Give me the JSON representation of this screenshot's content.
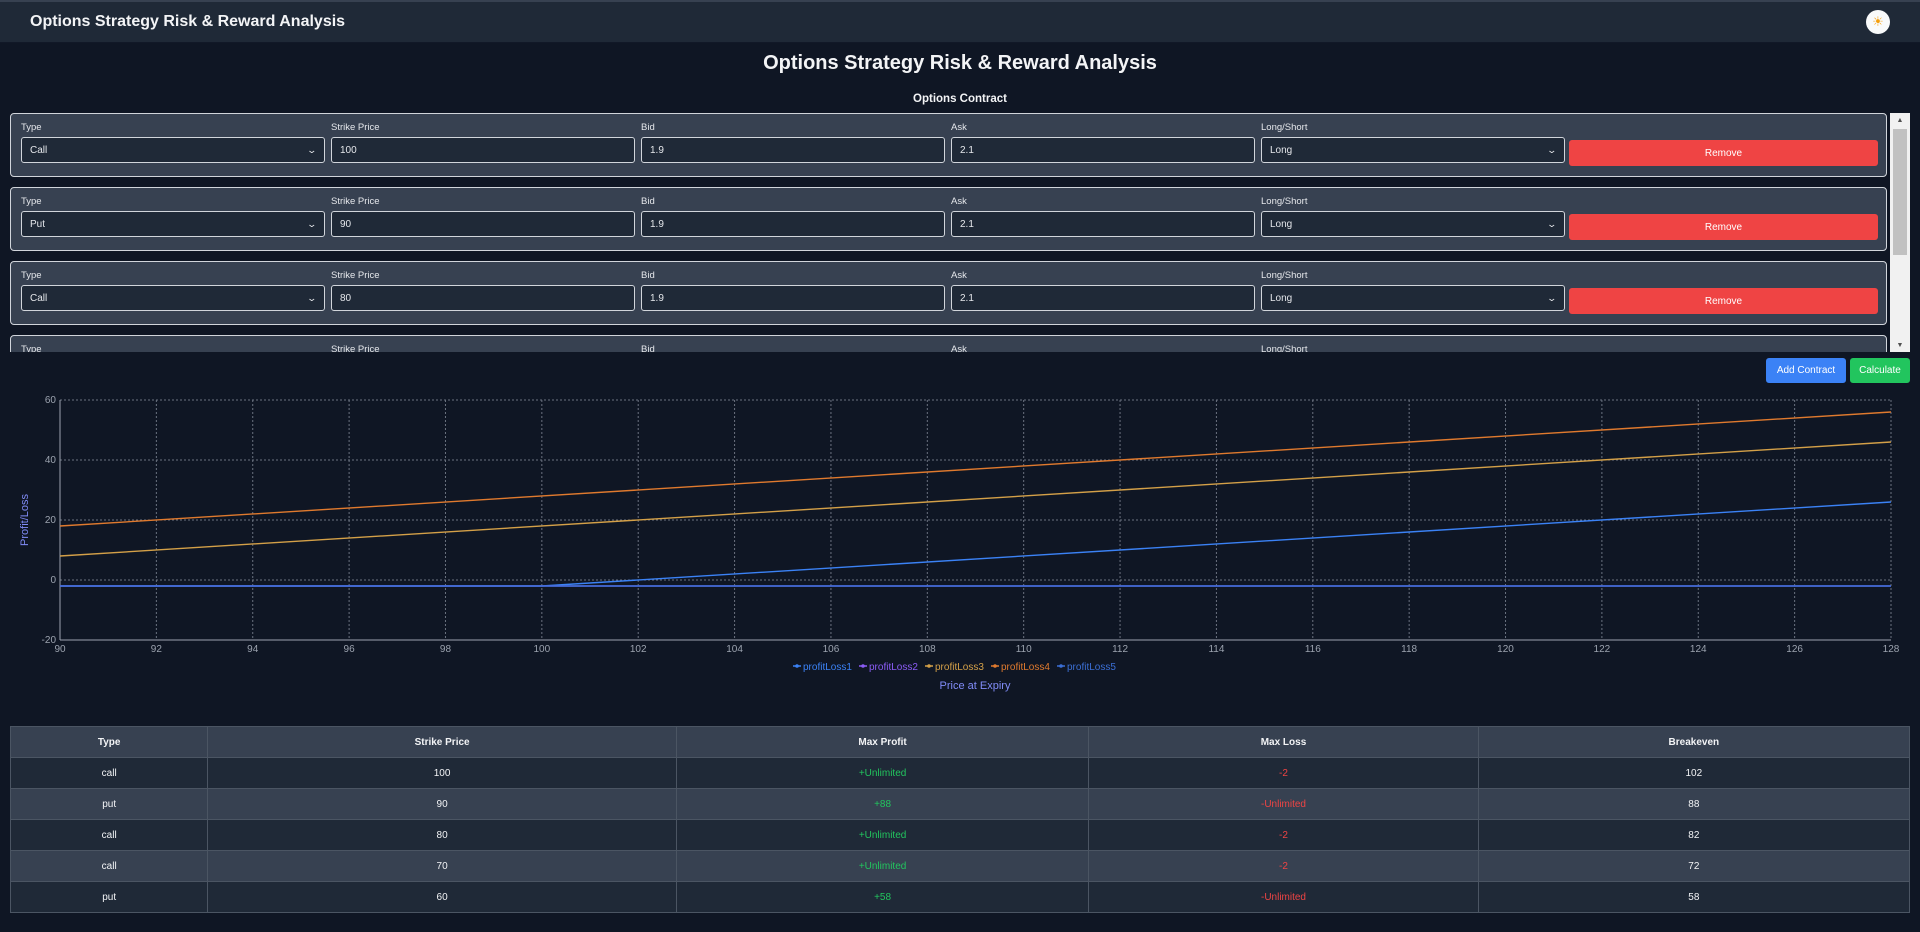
{
  "header": {
    "title": "Options Strategy Risk & Reward Analysis",
    "theme_icon": "sun-icon"
  },
  "page": {
    "title": "Options Strategy Risk & Reward Analysis",
    "section_label": "Options Contract"
  },
  "field_labels": {
    "type": "Type",
    "strike": "Strike Price",
    "bid": "Bid",
    "ask": "Ask",
    "side": "Long/Short"
  },
  "contracts": [
    {
      "type": "Call",
      "strike": "100",
      "bid": "1.9",
      "ask": "2.1",
      "side": "Long",
      "remove_label": "Remove"
    },
    {
      "type": "Put",
      "strike": "90",
      "bid": "1.9",
      "ask": "2.1",
      "side": "Long",
      "remove_label": "Remove"
    },
    {
      "type": "Call",
      "strike": "80",
      "bid": "1.9",
      "ask": "2.1",
      "side": "Long",
      "remove_label": "Remove"
    },
    {
      "type": "",
      "strike": "",
      "bid": "",
      "ask": "",
      "side": "",
      "remove_label": "Remove"
    }
  ],
  "actions": {
    "add_label": "Add Contract",
    "calc_label": "Calculate"
  },
  "chart_data": {
    "type": "line",
    "xlabel": "Price at Expiry",
    "ylabel": "Profit/Loss",
    "xlim": [
      90,
      128
    ],
    "ylim": [
      -20,
      60
    ],
    "x_ticks": [
      "90",
      "92",
      "94",
      "96",
      "98",
      "100",
      "102",
      "104",
      "106",
      "108",
      "110",
      "112",
      "114",
      "116",
      "118",
      "120",
      "122",
      "124",
      "126",
      "128"
    ],
    "y_ticks": [
      "60",
      "40",
      "20",
      "0",
      "-20"
    ],
    "grid": true,
    "legend": "bottom",
    "series": [
      {
        "name": "profitLoss1",
        "color": "#3b82f6",
        "points": [
          [
            90,
            -2
          ],
          [
            100,
            -2
          ],
          [
            128,
            26
          ]
        ]
      },
      {
        "name": "profitLoss2",
        "color": "#8b5cf6",
        "points": [
          [
            90,
            -2
          ],
          [
            128,
            -2
          ]
        ]
      },
      {
        "name": "profitLoss3",
        "color": "#d4a048",
        "points": [
          [
            90,
            8
          ],
          [
            128,
            46
          ]
        ]
      },
      {
        "name": "profitLoss4",
        "color": "#e07a2e",
        "points": [
          [
            90,
            18
          ],
          [
            128,
            56
          ]
        ]
      },
      {
        "name": "profitLoss5",
        "color": "#3b6fd6",
        "points": [
          [
            90,
            -2
          ],
          [
            128,
            -2
          ]
        ]
      }
    ]
  },
  "results": {
    "headers": [
      "Type",
      "Strike Price",
      "Max Profit",
      "Max Loss",
      "Breakeven"
    ],
    "rows": [
      [
        "call",
        "100",
        "+Unlimited",
        "-2",
        "102"
      ],
      [
        "put",
        "90",
        "+88",
        "-Unlimited",
        "88"
      ],
      [
        "call",
        "80",
        "+Unlimited",
        "-2",
        "82"
      ],
      [
        "call",
        "70",
        "+Unlimited",
        "-2",
        "72"
      ],
      [
        "put",
        "60",
        "+58",
        "-Unlimited",
        "58"
      ]
    ]
  }
}
